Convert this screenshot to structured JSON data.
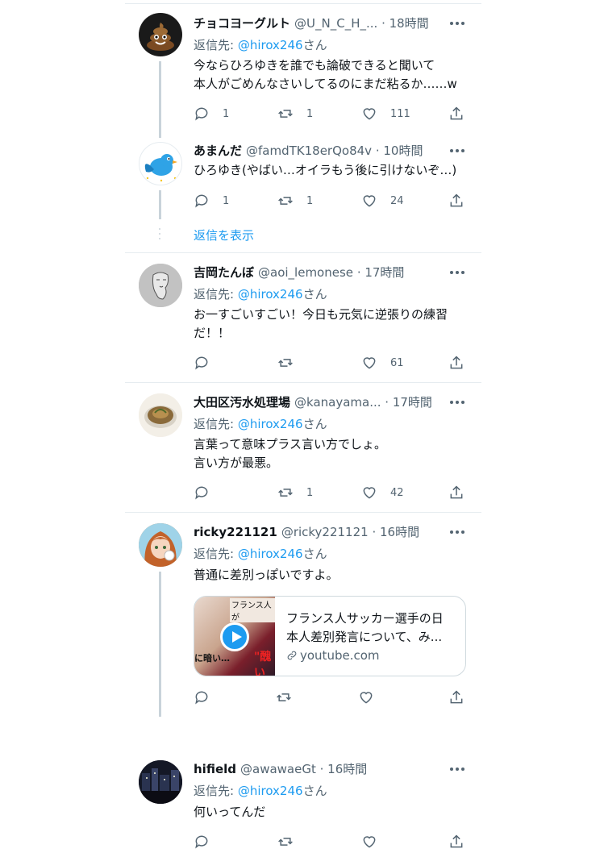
{
  "tweets": [
    {
      "name": "チョコヨーグルト",
      "handle": "@U_N_C_H_...",
      "time": "· 18時間",
      "reply_prefix": "返信先: ",
      "reply_to": "@hirox246",
      "reply_suffix": "さん",
      "lines": [
        "今ならひろゆきを誰でも論破できると聞いて",
        "本人がごめんなさいしてるのにまだ粘るか……w"
      ],
      "replies": "1",
      "retweets": "1",
      "likes": "111",
      "avatar_icon": "poop-emoji"
    },
    {
      "name": "あまんだ",
      "handle": "@famdTK18erQo84v",
      "time": "· 10時間",
      "lines": [
        "ひろゆき(やばい…オイラもう後に引けないぞ…)"
      ],
      "replies": "1",
      "retweets": "1",
      "likes": "24",
      "avatar_icon": "blue-bird"
    },
    {
      "name": "吉岡たんぼ",
      "handle": "@aoi_lemonese",
      "time": "· 17時間",
      "reply_prefix": "返信先: ",
      "reply_to": "@hirox246",
      "reply_suffix": "さん",
      "lines": [
        "お一すごいすごい！今日も元気に逆張りの練習",
        "だ！！"
      ],
      "replies": "",
      "retweets": "",
      "likes": "61",
      "avatar_icon": "sketch-portrait"
    },
    {
      "name": "大田区汚水処理場",
      "handle": "@kanayama...",
      "time": "· 17時間",
      "reply_prefix": "返信先: ",
      "reply_to": "@hirox246",
      "reply_suffix": "さん",
      "lines": [
        "言葉って意味プラス言い方でしょ。",
        "言い方が最悪。"
      ],
      "replies": "",
      "retweets": "1",
      "likes": "42",
      "avatar_icon": "food-bowl"
    },
    {
      "name": "ricky221121",
      "handle": "@ricky221121",
      "time": "· 16時間",
      "reply_prefix": "返信先: ",
      "reply_to": "@hirox246",
      "reply_suffix": "さん",
      "lines": [
        "普通に差別っぽいですよ。"
      ],
      "card": {
        "title_line1": "フランス人サッカー選手の日",
        "title_line2": "本人差別発言について、み...",
        "domain": "youtube.com",
        "thumb_top": "フランス人が",
        "thumb_bottom_left": "に暗い…",
        "thumb_bottom_right": "\"醜い"
      },
      "replies": "",
      "retweets": "",
      "likes": "",
      "avatar_icon": "anime-girl"
    },
    {
      "name": "hifield",
      "handle": "@awawaeGt",
      "time": "· 16時間",
      "reply_prefix": "返信先: ",
      "reply_to": "@hirox246",
      "reply_suffix": "さん",
      "lines": [
        "何いってんだ"
      ],
      "replies": "",
      "retweets": "",
      "likes": "",
      "avatar_icon": "night-city"
    }
  ],
  "show_replies": "返信を表示",
  "colors": {
    "accent": "#1d9bf0",
    "muted": "#536471",
    "text": "#0f1419",
    "divider": "#e6ecf0"
  }
}
